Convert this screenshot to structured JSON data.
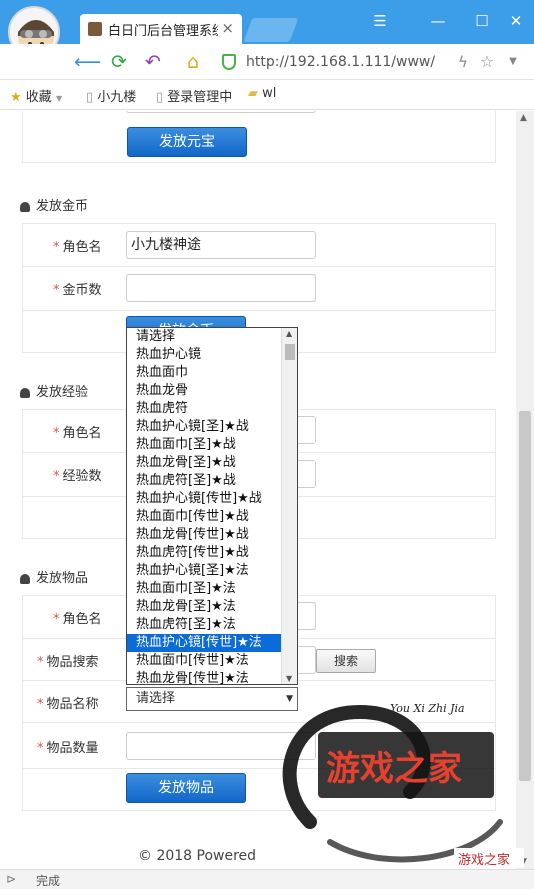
{
  "browser": {
    "tab_title": "白日门后台管理系统-W",
    "tab_close": "×",
    "url": "http://192.168.1.111/www/",
    "window_buttons": {
      "menu": "☰",
      "minimize": "—",
      "maximize": "☐",
      "close": "✕"
    },
    "bookmarks": [
      {
        "label": "收藏",
        "icon": "star-icon"
      },
      {
        "label": "小九楼",
        "icon": "page-icon"
      },
      {
        "label": "登录管理中",
        "icon": "page-icon"
      },
      {
        "label": "wl",
        "icon": "folder-icon"
      }
    ],
    "status": "完成"
  },
  "sections": {
    "yuanbao": {
      "button": "发放元宝"
    },
    "gold": {
      "title": "发放金币",
      "role_label": "角色名",
      "role_value": "小九楼神途",
      "amount_label": "金币数",
      "button": "发放金币"
    },
    "exp": {
      "title": "发放经验",
      "role_label": "角色名",
      "amount_label": "经验数"
    },
    "item": {
      "title": "发放物品",
      "role_label": "角色名",
      "search_label": "物品搜索",
      "search_button": "搜索",
      "name_label": "物品名称",
      "select_value": "请选择",
      "qty_label": "物品数量",
      "button": "发放物品"
    }
  },
  "dropdown_options": [
    "请选择",
    "热血护心镜",
    "热血面巾",
    "热血龙骨",
    "热血虎符",
    "热血护心镜[圣]★战",
    "热血面巾[圣]★战",
    "热血龙骨[圣]★战",
    "热血虎符[圣]★战",
    "热血护心镜[传世]★战",
    "热血面巾[传世]★战",
    "热血龙骨[传世]★战",
    "热血虎符[传世]★战",
    "热血护心镜[圣]★法",
    "热血面巾[圣]★法",
    "热血龙骨[圣]★法",
    "热血虎符[圣]★法",
    "热血护心镜[传世]★法",
    "热血面巾[传世]★法",
    "热血龙骨[传世]★法"
  ],
  "selected_option_index": 17,
  "footer": "© 2018 Powered",
  "watermark": {
    "script": "You Xi Zhi Jia",
    "main": "游戏之家",
    "sub": "游戏之家"
  },
  "colors": {
    "titlebar": "#3c9ee8",
    "button": "#1a72d4",
    "required": "#d9534f",
    "selected": "#0b6bd9"
  }
}
